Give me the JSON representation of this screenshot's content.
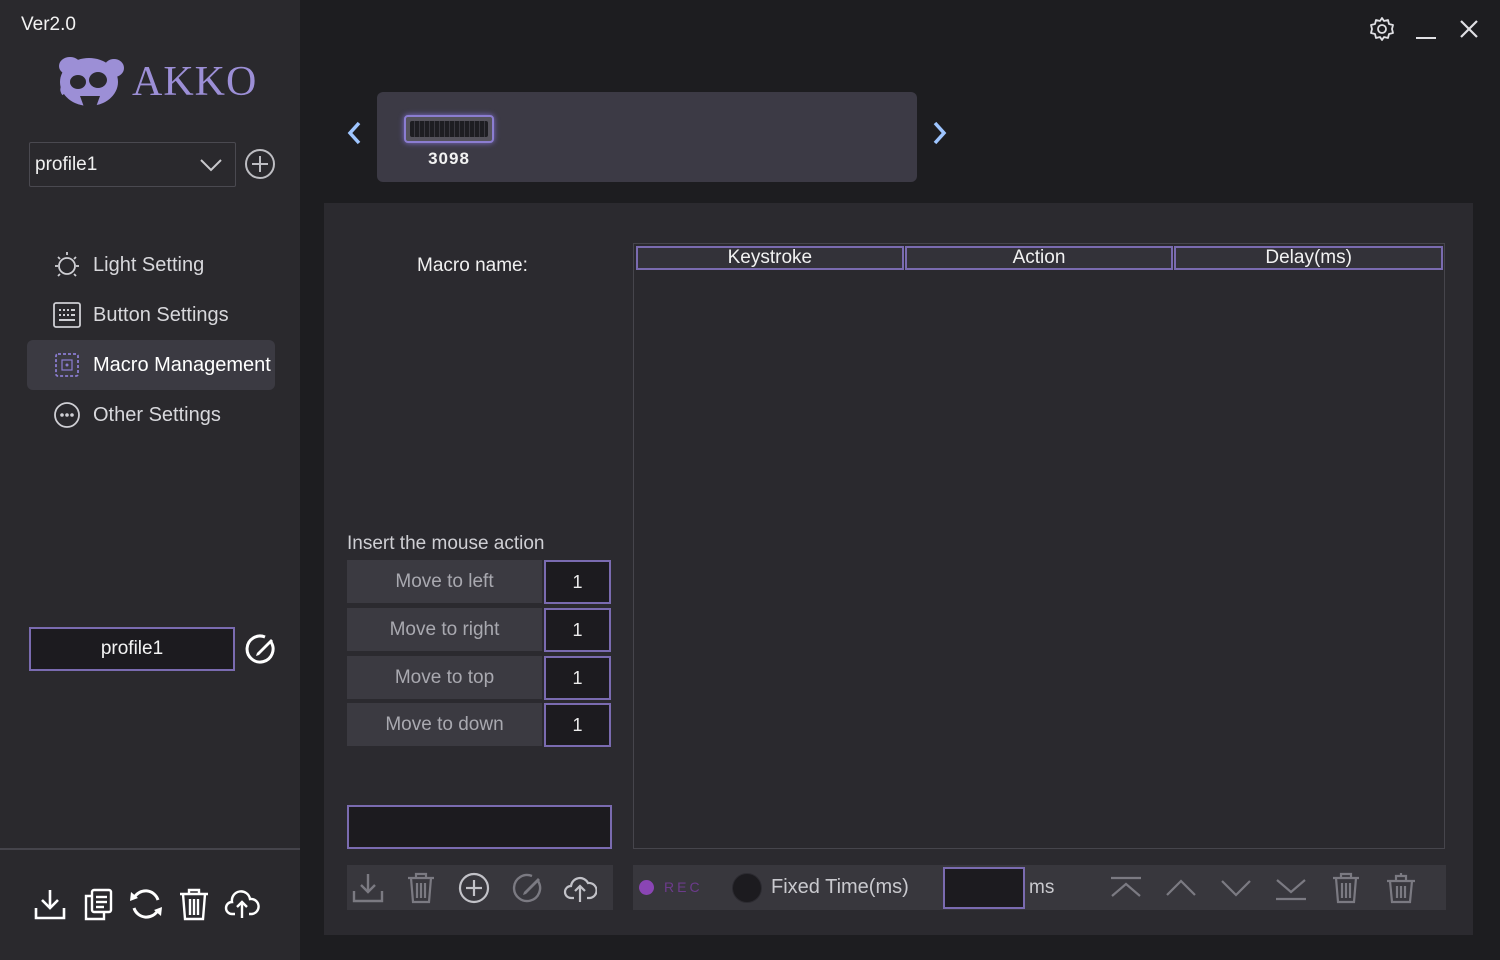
{
  "app": {
    "version": "Ver2.0",
    "logo_text": "AKKO"
  },
  "sidebar": {
    "profile_select": {
      "value": "profile1"
    },
    "nav": [
      {
        "label": "Light Setting",
        "icon": "sun-icon",
        "active": false
      },
      {
        "label": "Button Settings",
        "icon": "keyboard-icon",
        "active": false
      },
      {
        "label": "Macro Management",
        "icon": "chip-icon",
        "active": true
      },
      {
        "label": "Other Settings",
        "icon": "more-icon",
        "active": false
      }
    ],
    "profile_name": "profile1",
    "bottom_actions": [
      "download-icon",
      "copy-icon",
      "reset-icon",
      "trash-icon",
      "cloud-upload-icon"
    ]
  },
  "device": {
    "name": "3098"
  },
  "macro": {
    "name_label": "Macro name:",
    "insert_label": "Insert the mouse action",
    "moves": [
      {
        "label": "Move to left",
        "value": "1"
      },
      {
        "label": "Move to right",
        "value": "1"
      },
      {
        "label": "Move to top",
        "value": "1"
      },
      {
        "label": "Move to down",
        "value": "1"
      }
    ],
    "columns": [
      "Keystroke",
      "Action",
      "Delay(ms)"
    ],
    "rec_label": "REC",
    "fixed_time_label": "Fixed Time(ms)",
    "ms_unit": "ms"
  },
  "colors": {
    "accent": "#7a6bb0",
    "rec": "#8a45b4",
    "logo": "#9c8fd6"
  }
}
